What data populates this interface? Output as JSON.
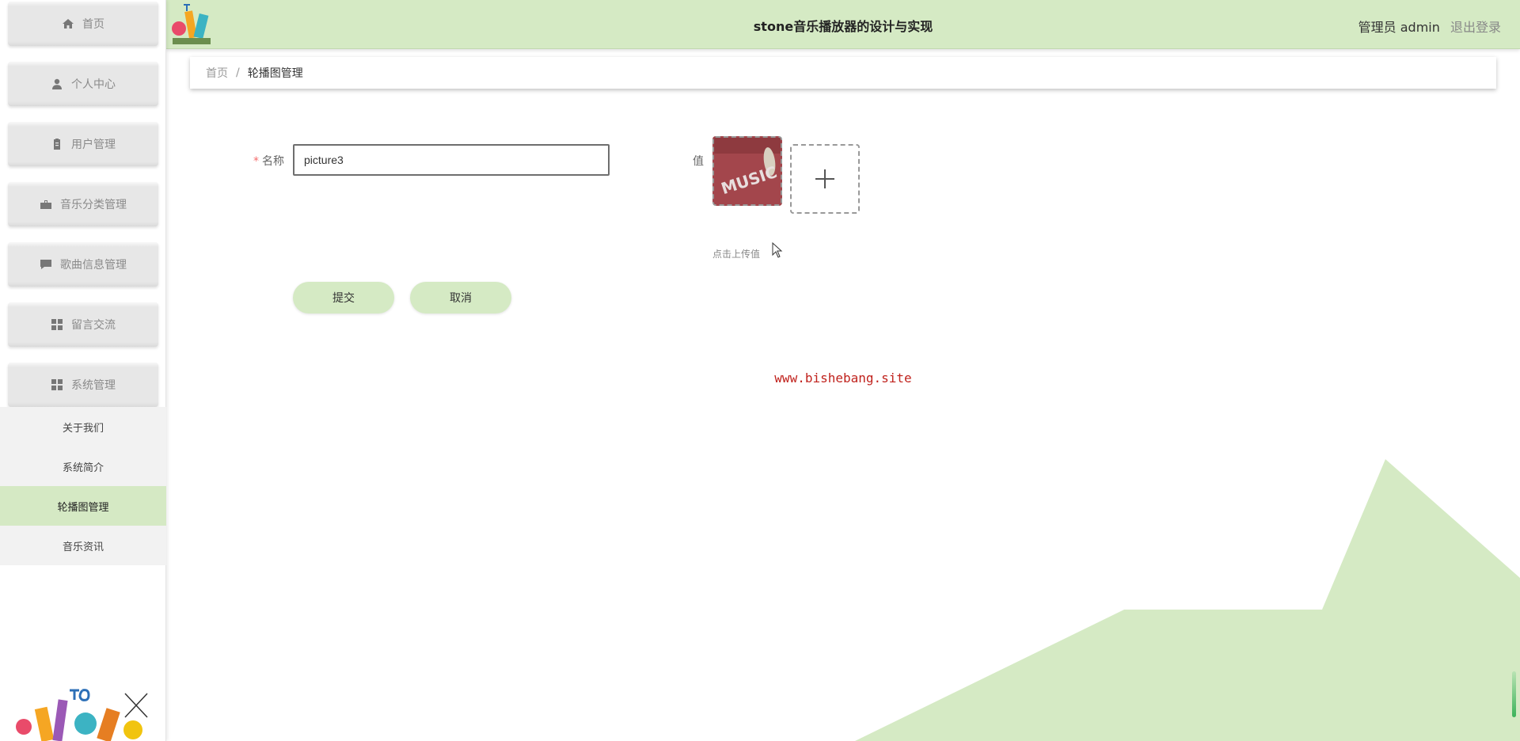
{
  "header": {
    "title": "stone音乐播放器的设计与实现",
    "user_label": "管理员 admin",
    "logout_label": "退出登录"
  },
  "sidebar": {
    "menu": [
      {
        "label": "首页",
        "icon": "home-icon"
      },
      {
        "label": "个人中心",
        "icon": "user-icon"
      },
      {
        "label": "用户管理",
        "icon": "clipboard-icon"
      },
      {
        "label": "音乐分类管理",
        "icon": "briefcase-icon"
      },
      {
        "label": "歌曲信息管理",
        "icon": "chat-icon"
      },
      {
        "label": "留言交流",
        "icon": "grid-icon"
      },
      {
        "label": "系统管理",
        "icon": "grid-icon"
      }
    ],
    "submenu": [
      {
        "label": "关于我们"
      },
      {
        "label": "系统简介"
      },
      {
        "label": "轮播图管理",
        "active": true
      },
      {
        "label": "音乐资讯"
      }
    ]
  },
  "breadcrumb": {
    "home": "首页",
    "separator": "/",
    "current": "轮播图管理"
  },
  "form": {
    "name_label": "名称",
    "name_required_mark": "*",
    "name_value": "picture3",
    "value_label": "值",
    "upload_hint": "点击上传值",
    "submit_label": "提交",
    "cancel_label": "取消"
  },
  "thumbnail_text": "MUSIC",
  "watermark": "www.bishebang.site",
  "colors": {
    "accent": "#d5eac4",
    "active_submenu": "#d5e9c4",
    "watermark": "#c0221d",
    "required": "#f56c6c"
  }
}
